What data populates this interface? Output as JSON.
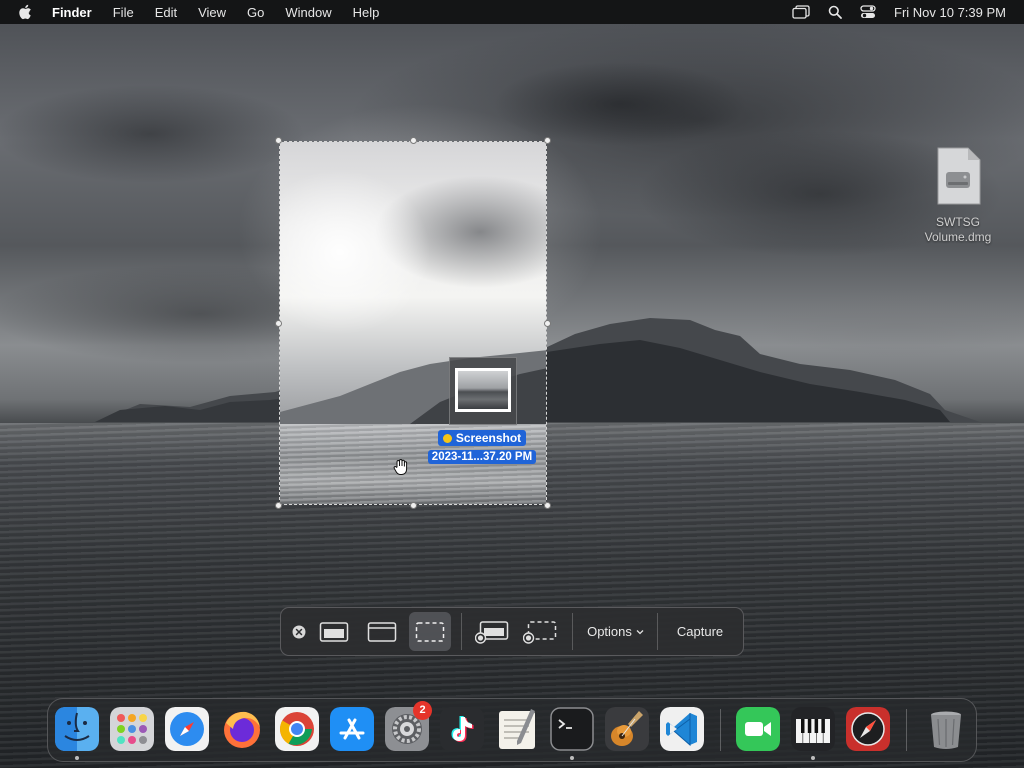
{
  "menubar": {
    "app_name": "Finder",
    "menus": [
      "File",
      "Edit",
      "View",
      "Go",
      "Window",
      "Help"
    ],
    "status_icons": [
      "window-icon",
      "search-icon",
      "control-center-icon"
    ],
    "clock": "Fri Nov 10  7:39 PM"
  },
  "desktop": {
    "icon_label_line1": "SWTSG",
    "icon_label_line2": "Volume.dmg"
  },
  "thumbnail": {
    "title": "Screenshot",
    "subtitle": "2023-11...37.20 PM",
    "tag_color": "#f5c518"
  },
  "toolbar": {
    "buttons": [
      {
        "name": "close-toolbar-icon"
      },
      {
        "name": "capture-entire-screen-icon"
      },
      {
        "name": "capture-window-icon"
      },
      {
        "name": "capture-selection-icon",
        "selected": true
      },
      {
        "name": "record-entire-screen-icon"
      },
      {
        "name": "record-selection-icon"
      }
    ],
    "options_label": "Options",
    "capture_label": "Capture"
  },
  "dock": {
    "apps": [
      "Finder",
      "Launchpad",
      "Safari",
      "Firefox",
      "Chrome",
      "App Store",
      "System Settings",
      "TikTok",
      "TextEdit",
      "Terminal",
      "GarageBand",
      "Visual Studio Code",
      "FaceTime",
      "Piano",
      "Compass",
      "Trash"
    ],
    "system_settings_badge": "2"
  },
  "colors": {
    "selection_label_bg": "#2064d8",
    "menubar_bg": "#141516"
  }
}
